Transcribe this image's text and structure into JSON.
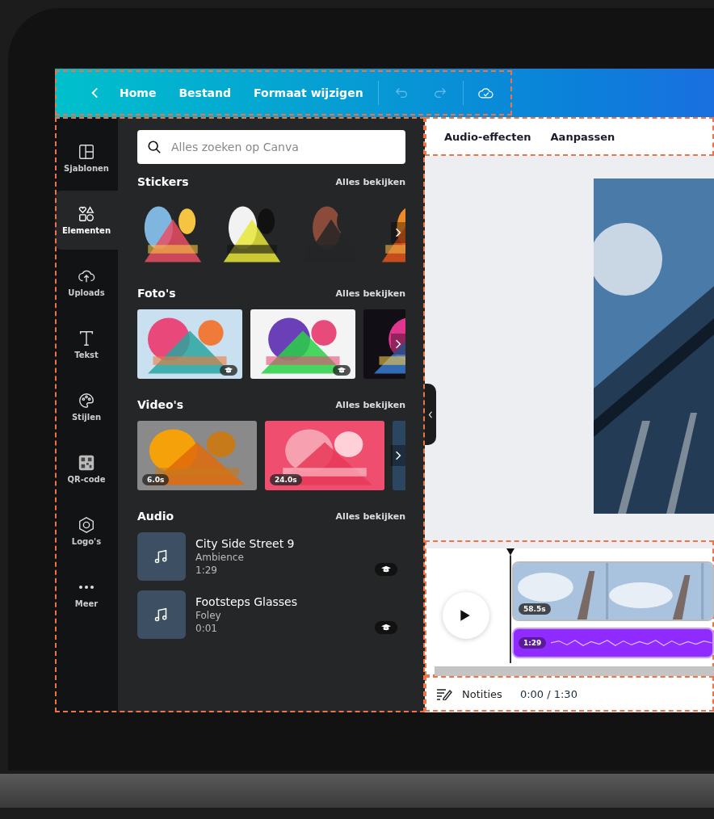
{
  "topbar": {
    "back_label": "Home",
    "menu": [
      "Bestand",
      "Formaat wijzigen"
    ]
  },
  "rail": [
    {
      "label": "Sjablonen",
      "kind": "templates",
      "selected": false
    },
    {
      "label": "Elementen",
      "kind": "elements",
      "selected": true
    },
    {
      "label": "Uploads",
      "kind": "uploads",
      "selected": false
    },
    {
      "label": "Tekst",
      "kind": "text",
      "selected": false
    },
    {
      "label": "Stijlen",
      "kind": "styles",
      "selected": false
    },
    {
      "label": "QR-code",
      "kind": "qr",
      "selected": false
    },
    {
      "label": "Logo's",
      "kind": "logos",
      "selected": false
    },
    {
      "label": "Meer",
      "kind": "more",
      "selected": false
    }
  ],
  "search": {
    "placeholder": "Alles zoeken op Canva"
  },
  "sections": [
    {
      "title": "Stickers",
      "link": "Alles bekijken",
      "kind": "stickers",
      "items": [
        {
          "kind": "picture"
        },
        {
          "kind": "picture"
        },
        {
          "kind": "picture"
        },
        {
          "kind": "picture"
        }
      ]
    },
    {
      "title": "Foto's",
      "link": "Alles bekijken",
      "kind": "photos",
      "items": [
        {
          "kind": "picture",
          "premium": true
        },
        {
          "kind": "picture",
          "premium": true
        },
        {
          "kind": "picture"
        }
      ]
    },
    {
      "title": "Video's",
      "link": "Alles bekijken",
      "kind": "videos",
      "items": [
        {
          "kind": "picture",
          "duration": "6.0s"
        },
        {
          "kind": "picture",
          "duration": "24.0s"
        },
        {
          "kind": "picture"
        }
      ]
    },
    {
      "title": "Audio",
      "link": "Alles bekijken",
      "kind": "audio",
      "tracks": [
        {
          "title": "City Side Street 9",
          "category": "Ambience",
          "duration": "1:29",
          "premium": true
        },
        {
          "title": "Footsteps Glasses",
          "category": "Foley",
          "duration": "0:01",
          "premium": true
        }
      ]
    }
  ],
  "effects_bar": [
    "Audio-effecten",
    "Aanpassen"
  ],
  "timeline": {
    "video_duration": "58.5s",
    "audio_duration": "1:29"
  },
  "footer": {
    "notes": "Notities",
    "time": "0:00 / 1:30"
  }
}
